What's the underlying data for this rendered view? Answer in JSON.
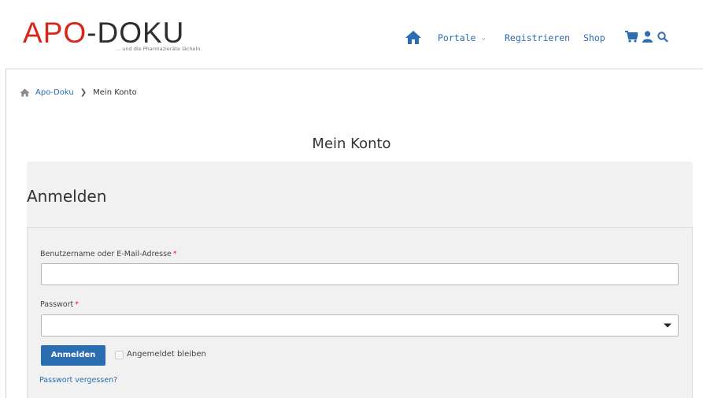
{
  "header": {
    "logo": {
      "first": "A",
      "middle": "PO",
      "rest": "-DOKU",
      "tagline": "... und die Pharmazieräte lächeln."
    },
    "nav": {
      "home_icon": "home-icon",
      "portale": "Portale",
      "registrieren": "Registrieren",
      "shop": "Shop",
      "icons": [
        "cart-icon",
        "user-icon",
        "search-icon"
      ]
    }
  },
  "breadcrumb": {
    "home_icon": "home-icon",
    "items": [
      {
        "label": "Apo-Doku"
      },
      {
        "label": "Mein Konto"
      }
    ]
  },
  "page": {
    "title": "Mein Konto"
  },
  "login": {
    "title": "Anmelden",
    "username_label": "Benutzername oder E-Mail-Adresse",
    "username_value": "",
    "password_label": "Passwort",
    "password_value": "",
    "required_mark": "*",
    "submit_label": "Anmelden",
    "remember_label": "Angemeldet bleiben",
    "remember_checked": false,
    "forgot_label": "Passwort vergessen?"
  },
  "colors": {
    "brand_red": "#d9261c",
    "link_blue": "#2a6db0",
    "button_blue": "#2a6db0",
    "panel_bg": "#f1f1f1"
  }
}
